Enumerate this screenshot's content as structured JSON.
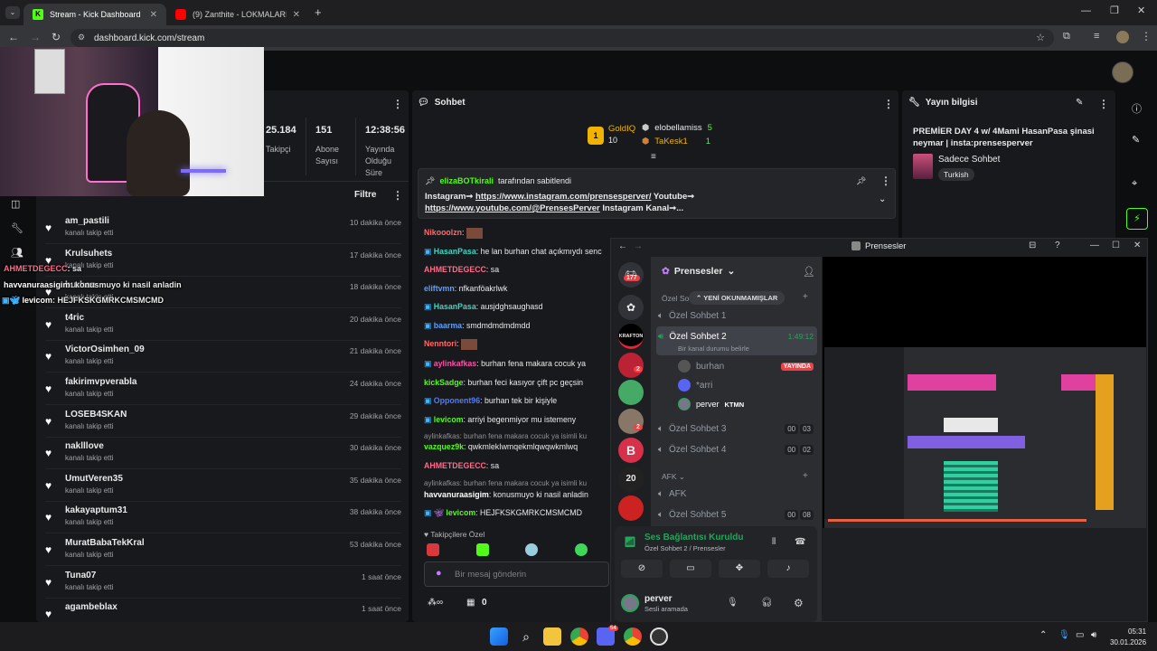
{
  "browser": {
    "tabs": [
      {
        "title": "Stream - Kick Dashboard",
        "active": true,
        "icon": "kick-icon"
      },
      {
        "title": "(9) Zanthite - LOKMALARIN HAKİ",
        "active": false,
        "icon": "youtube-icon"
      }
    ],
    "url": "dashboard.kick.com/stream"
  },
  "stats": [
    {
      "value": "25.184",
      "label": "Takipçi"
    },
    {
      "value": "151",
      "label": "Abone Sayısı"
    },
    {
      "value": "12:38:56",
      "label": "Yayında Olduğu Süre"
    }
  ],
  "activity": {
    "filter_label": "Filtre",
    "items": [
      {
        "name": "am_pastili",
        "action": "kanalı takip etti",
        "time": "10 dakika önce"
      },
      {
        "name": "Krulsuhets",
        "action": "kanalı takip etti",
        "time": "17 dakika önce"
      },
      {
        "name": "burhan",
        "action": "kanalı takip etti",
        "time": "18 dakika önce"
      },
      {
        "name": "t4ric",
        "action": "kanalı takip etti",
        "time": "20 dakika önce"
      },
      {
        "name": "VictorOsimhen_09",
        "action": "kanalı takip etti",
        "time": "21 dakika önce"
      },
      {
        "name": "fakirimvpverabla",
        "action": "kanalı takip etti",
        "time": "24 dakika önce"
      },
      {
        "name": "LOSEB4SKAN",
        "action": "kanalı takip etti",
        "time": "29 dakika önce"
      },
      {
        "name": "naklllove",
        "action": "kanalı takip etti",
        "time": "30 dakika önce"
      },
      {
        "name": "UmutVeren35",
        "action": "kanalı takip etti",
        "time": "35 dakika önce"
      },
      {
        "name": "kakayaptum31",
        "action": "kanalı takip etti",
        "time": "38 dakika önce"
      },
      {
        "name": "MuratBabaTekKral",
        "action": "kanalı takip etti",
        "time": "53 dakika önce"
      },
      {
        "name": "Tuna07",
        "action": "kanalı takip etti",
        "time": "1 saat önce"
      },
      {
        "name": "agambeblax",
        "action": "",
        "time": "1 saat önce"
      }
    ]
  },
  "overlay_chat": [
    {
      "user": "AHMETDEGECC",
      "text": ": sa"
    },
    {
      "user": "havvanuraasigim",
      "text": ": konusmuyo ki nasil anladin"
    },
    {
      "user": "levicom",
      "text": ": HEJFKSKGMRKCMSMCMD"
    }
  ],
  "chat": {
    "title": "Sohbet",
    "leaderboard": [
      {
        "name": "GoldIQ",
        "value": "10"
      },
      {
        "name": "elobellamiss",
        "value": "5"
      },
      {
        "name": "TaKesk1",
        "value": "1"
      }
    ],
    "pinned": {
      "by": "elizaBOTkirali",
      "suffix": "tarafından sabitlendi",
      "line1_prefix": "Instagram➞ ",
      "link1": "https://www.instagram.com/prensesperver/",
      "line1_suffix": " Youtube➞",
      "link2": "https://www.youtube.com/@PrensesPerver",
      "line2_suffix": " Instagram Kanal➞..."
    },
    "messages": [
      {
        "user": "Nikooolzn",
        "text": ":",
        "color": "#ff6b6b"
      },
      {
        "user": "HasanPasa",
        "text": ": he lan burhan chat açıkmıydı senc",
        "color": "#3fd6c3"
      },
      {
        "user": "AHMETDEGECC",
        "text": ": sa",
        "color": "#ff6b8a"
      },
      {
        "user": "eliftvmn",
        "text": ": nfkanföakrlwk",
        "color": "#5aa0ff"
      },
      {
        "user": "HasanPasa",
        "text": ": ausjdghsaughasd",
        "color": "#3fd6c3"
      },
      {
        "user": "baarma",
        "text": ": smdmdmdmdmdd",
        "color": "#5aa0ff"
      },
      {
        "user": "Nenntori",
        "text": ":",
        "color": "#ff6b6b"
      },
      {
        "user": "aylinkafkas",
        "text": ": burhan fena makara cocuk ya",
        "color": "#ff4fa8"
      },
      {
        "user": "kickSadge",
        "text": ": burhan feci kasıyor çift pc geçsin",
        "color": "#53fc18"
      },
      {
        "user": "Opponent96",
        "text": ": burhan tek bir kişiyle",
        "color": "#4f7cff"
      },
      {
        "user": "levicom",
        "text": ": arriyi begenmiyor mu istemeny",
        "color": "#53fc18"
      }
    ],
    "reply1": "aylinkafkas: burhan fena makara cocuk ya isimli ku",
    "msg_after_reply1": {
      "user": "vazquez9k",
      "text": ": qwkmlekIwmqekmlqwqwkmlwq"
    },
    "msg_sa": {
      "user": "AHMETDEGECC",
      "text": ": sa"
    },
    "reply2": "aylinkafkas: burhan fena makara cocuk ya isimli ku",
    "msg_havva": {
      "user": "havvanuraasigim",
      "text": ": konusmuyo ki nasil anladin"
    },
    "msg_levi": {
      "user": "levicom",
      "text": ": HEJFKSKGMRKCMSMCMD"
    },
    "followers_only": "Takipçilere Özel",
    "placeholder": "Bir mesaj gönderin",
    "points": "0"
  },
  "stream_info": {
    "title": "Yayın bilgisi",
    "stream_title": "PREMİER DAY 4 w/ 4Mami HasanPasa şinasi neymar | insta:prensesperver",
    "category": "Sadece Sohbet",
    "tag": "Turkish"
  },
  "discord": {
    "window_title": "Prensesler",
    "server_name": "Prensesler",
    "unread_pill": "YENİ OKUNMAMIŞLAR",
    "category1": "Özel So",
    "channels_top": [
      {
        "name": "Özel Sohbet 1"
      },
      {
        "name": "Özel Sohbet 2",
        "timer": "1:49:12",
        "status": "Bir kanal durumu belirle"
      }
    ],
    "members": [
      {
        "name": "burhan",
        "badge": "YAYINDA"
      },
      {
        "name": "*arri",
        "badge": ""
      },
      {
        "name": "perver",
        "badge": "KTMN"
      }
    ],
    "channels_mid": [
      {
        "name": "Özel Sohbet 3",
        "a": "00",
        "b": "03"
      },
      {
        "name": "Özel Sohbet 4",
        "a": "00",
        "b": "02"
      }
    ],
    "category2": "AFK",
    "channels_bottom": [
      {
        "name": "AFK",
        "a": "",
        "b": ""
      },
      {
        "name": "Özel Sohbet 5",
        "a": "00",
        "b": "08"
      }
    ],
    "voice_status": "Ses Bağlantısı Kuruldu",
    "voice_channel": "Özel Sohbet 2 / Prensesler",
    "user_name": "perver",
    "user_status": "Sesli aramada",
    "server_badges": [
      "177",
      "2",
      "2"
    ],
    "server_labels": [
      "KRAFTON",
      "20"
    ]
  },
  "taskbar": {
    "time": "05:31",
    "date": "30.01.2026",
    "discord_badge": "54"
  },
  "colors": {
    "kick_green": "#53fc18",
    "discord_green": "#23a55a",
    "discord_red": "#f23f43"
  }
}
